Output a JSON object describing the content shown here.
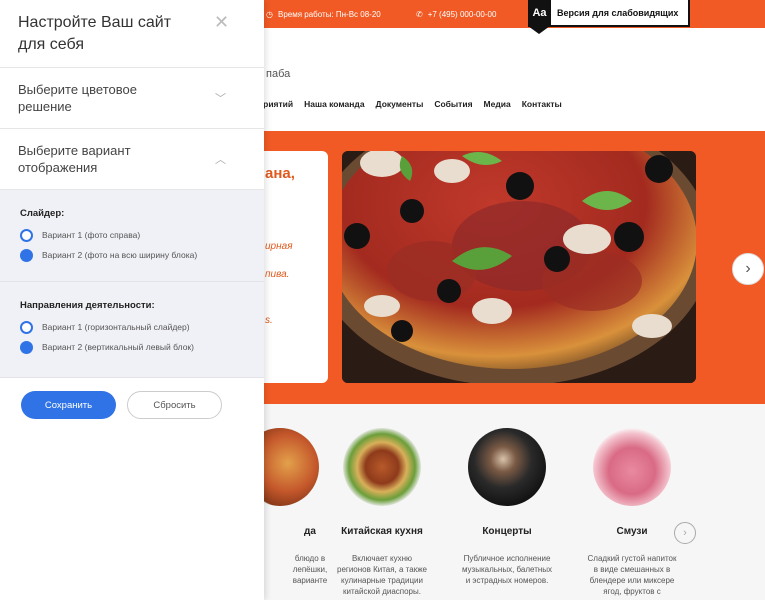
{
  "topbar": {
    "hours": "Время работы: Пн-Вс 08-20",
    "phone": "+7 (495) 000-00-00",
    "vision_badge": "Aa",
    "vision_label": "Версия для слабовидящих",
    "accent": "#f15a24"
  },
  "brand": "паба",
  "nav": [
    "приятий",
    "Наша команда",
    "Документы",
    "События",
    "Медиа",
    "Контакты"
  ],
  "hero": {
    "title1": "ана,",
    "title2": "",
    "text1": "ирная",
    "text1b": "пива.",
    "text2": "s."
  },
  "features": [
    {
      "title": "да",
      "desc": "блюдо в\nлепёшки,\nварианте"
    },
    {
      "title": "Китайская кухня",
      "desc": "Включает кухню\nрегионов Китая, а также\nкулинарные традиции\nкитайской диаспоры."
    },
    {
      "title": "Концерты",
      "desc": "Публичное исполнение\nмузыкальных, балетных\nи эстрадных номеров."
    },
    {
      "title": "Смузи",
      "desc": "Сладкий густой напиток\nв виде смешанных в\nблендере или миксере\nягод, фруктов с"
    }
  ],
  "panel": {
    "title": "Настройте Ваш сайт для себя",
    "color_section": "Выберите цветовое решение",
    "display_section": "Выберите вариант отображения",
    "slider_group": "Слайдер:",
    "slider_options": [
      "Вариант 1 (фото справа)",
      "Вариант 2 (фото на всю ширину блока)"
    ],
    "activity_group": "Направления деятельности:",
    "activity_options": [
      "Вариант 1 (горизонтальный слайдер)",
      "Вариант 2 (вертикальный левый блок)"
    ],
    "save_label": "Сохранить",
    "reset_label": "Сбросить",
    "primary": "#2f73e6"
  }
}
